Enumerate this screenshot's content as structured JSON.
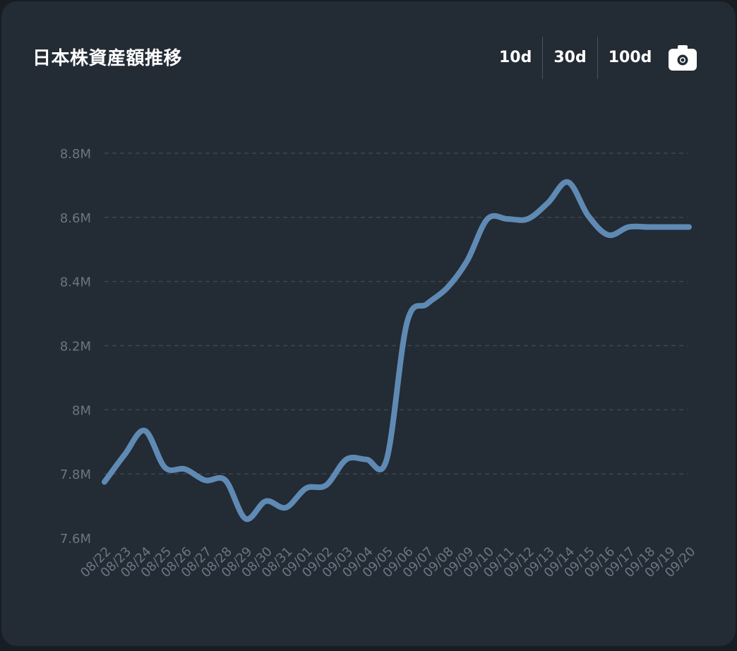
{
  "header": {
    "title": "日本株資産額推移",
    "ranges": [
      "10d",
      "30d",
      "100d"
    ]
  },
  "icons": {
    "camera": "camera-icon"
  },
  "colors": {
    "background": "#232b35",
    "line": "#5f8ab4",
    "grid": "#3d4652",
    "tick": "#6b7683"
  },
  "chart_data": {
    "type": "line",
    "title": "日本株資産額推移",
    "xlabel": "",
    "ylabel": "",
    "ylim": [
      7.6,
      8.8
    ],
    "yticks": [
      "7.6M",
      "7.8M",
      "8M",
      "8.2M",
      "8.4M",
      "8.6M",
      "8.8M"
    ],
    "grid": true,
    "categories": [
      "08/22",
      "08/23",
      "08/24",
      "08/25",
      "08/26",
      "08/27",
      "08/28",
      "08/29",
      "08/30",
      "08/31",
      "09/01",
      "09/02",
      "09/03",
      "09/04",
      "09/05",
      "09/06",
      "09/07",
      "09/08",
      "09/09",
      "09/10",
      "09/11",
      "09/12",
      "09/13",
      "09/14",
      "09/15",
      "09/16",
      "09/17",
      "09/18",
      "09/19",
      "09/20"
    ],
    "series": [
      {
        "values": [
          7.775,
          7.86,
          7.935,
          7.82,
          7.815,
          7.78,
          7.78,
          7.66,
          7.715,
          7.695,
          7.755,
          7.765,
          7.845,
          7.845,
          7.845,
          8.27,
          8.33,
          8.38,
          8.465,
          8.595,
          8.595,
          8.595,
          8.645,
          8.71,
          8.605,
          8.545,
          8.57,
          8.57,
          8.57,
          8.57
        ]
      }
    ]
  }
}
